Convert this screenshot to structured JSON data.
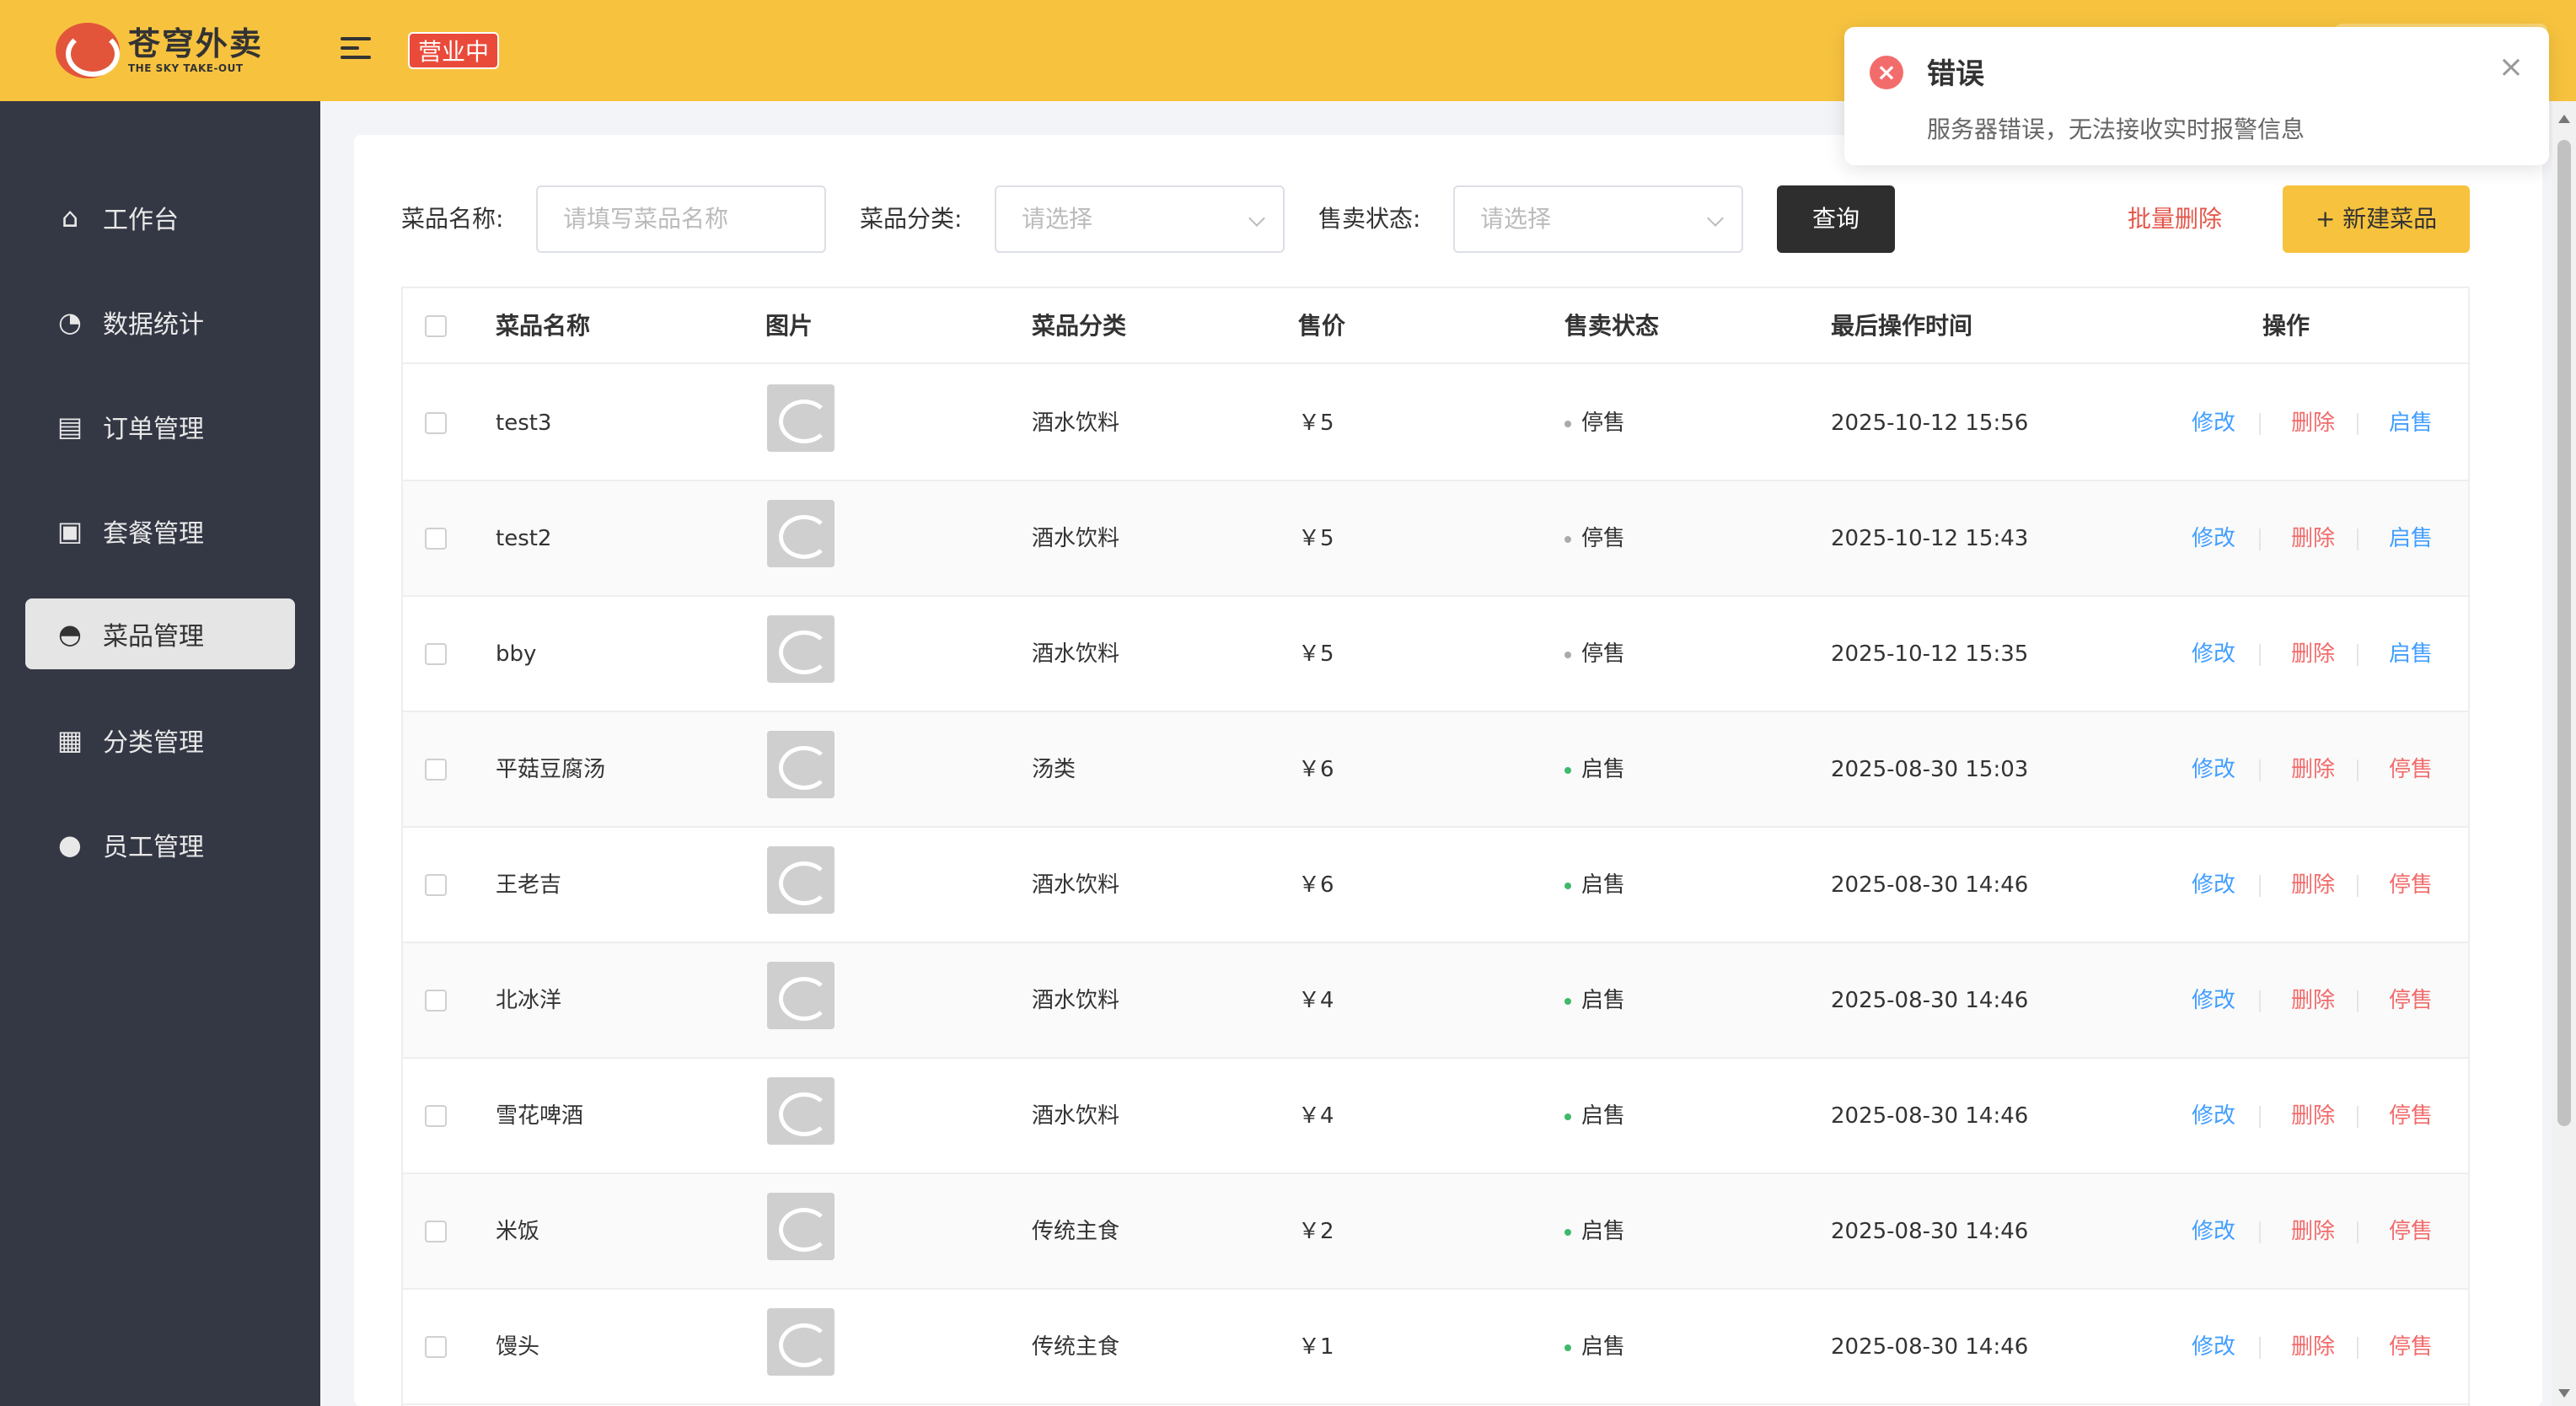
{
  "app": {
    "logo_cn": "苍穹外卖",
    "logo_en": "THE SKY TAKE-OUT",
    "status": "营业中"
  },
  "sidebar": {
    "items": [
      {
        "label": "工作台",
        "icon": "home-icon"
      },
      {
        "label": "数据统计",
        "icon": "chart-icon"
      },
      {
        "label": "订单管理",
        "icon": "clipboard-icon"
      },
      {
        "label": "套餐管理",
        "icon": "gift-icon"
      },
      {
        "label": "菜品管理",
        "icon": "cloche-icon",
        "active": true
      },
      {
        "label": "分类管理",
        "icon": "grid-icon"
      },
      {
        "label": "员工管理",
        "icon": "employee-icon"
      }
    ]
  },
  "filters": {
    "name_label": "菜品名称:",
    "name_placeholder": "请填写菜品名称",
    "category_label": "菜品分类:",
    "category_placeholder": "请选择",
    "status_label": "售卖状态:",
    "status_placeholder": "请选择",
    "query_label": "查询",
    "batch_delete_label": "批量删除",
    "new_label": "+ 新建菜品"
  },
  "table": {
    "headers": [
      "菜品名称",
      "图片",
      "菜品分类",
      "售价",
      "售卖状态",
      "最后操作时间",
      "操作"
    ],
    "actions": {
      "edit": "修改",
      "delete": "删除"
    },
    "rows": [
      {
        "name": "test3",
        "category": "酒水饮料",
        "price": "￥5",
        "status": "停售",
        "time": "2025-10-12 15:56",
        "toggle": "启售"
      },
      {
        "name": "test2",
        "category": "酒水饮料",
        "price": "￥5",
        "status": "停售",
        "time": "2025-10-12 15:43",
        "toggle": "启售"
      },
      {
        "name": "bby",
        "category": "酒水饮料",
        "price": "￥5",
        "status": "停售",
        "time": "2025-10-12 15:35",
        "toggle": "启售"
      },
      {
        "name": "平菇豆腐汤",
        "category": "汤类",
        "price": "￥6",
        "status": "启售",
        "time": "2025-08-30 15:03",
        "toggle": "停售"
      },
      {
        "name": "王老吉",
        "category": "酒水饮料",
        "price": "￥6",
        "status": "启售",
        "time": "2025-08-30 14:46",
        "toggle": "停售"
      },
      {
        "name": "北冰洋",
        "category": "酒水饮料",
        "price": "￥4",
        "status": "启售",
        "time": "2025-08-30 14:46",
        "toggle": "停售"
      },
      {
        "name": "雪花啤酒",
        "category": "酒水饮料",
        "price": "￥4",
        "status": "启售",
        "time": "2025-08-30 14:46",
        "toggle": "停售"
      },
      {
        "name": "米饭",
        "category": "传统主食",
        "price": "￥2",
        "status": "启售",
        "time": "2025-08-30 14:46",
        "toggle": "停售"
      },
      {
        "name": "馒头",
        "category": "传统主食",
        "price": "￥1",
        "status": "启售",
        "time": "2025-08-30 14:46",
        "toggle": "停售"
      }
    ]
  },
  "toast": {
    "title": "错误",
    "message": "服务器错误，无法接收实时报警信息"
  }
}
